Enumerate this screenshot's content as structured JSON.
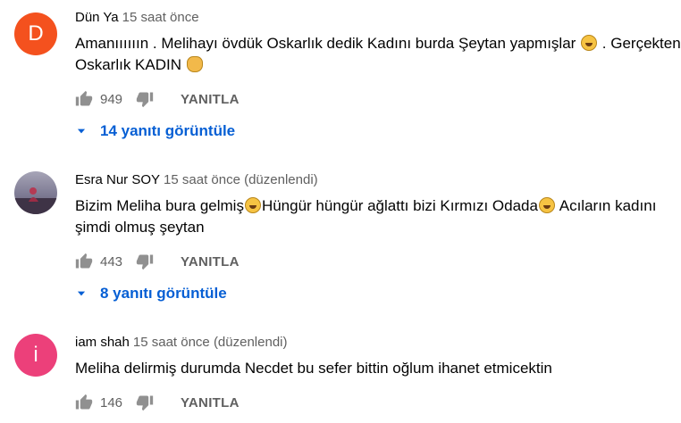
{
  "comments": [
    {
      "author": "Dün Ya",
      "time": "15 saat önce",
      "avatar_letter": "D",
      "avatar_color": "#f4511e",
      "text_line1_a": "Amanıııııın . Melihayı övdük Oskarlık dedik Kadını burda Şeytan yapmışlar",
      "text_line1_b": " . Gerçekten",
      "text_line2": "Oskarlık KADIN",
      "likes": "949",
      "reply_label": "YANITLA",
      "replies_label": "14 yanıtı görüntüle"
    },
    {
      "author": "Esra Nur SOY",
      "time": "15 saat önce (düzenlendi)",
      "text_line1_a": "Bizim Meliha bura gelmiş",
      "text_line1_b": "Hüngür hüngür ağlattı bizi Kırmızı Odada",
      "text_line1_c": "Acıların kadını",
      "text_line2": "şimdi olmuş şeytan",
      "likes": "443",
      "reply_label": "YANITLA",
      "replies_label": "8 yanıtı görüntüle"
    },
    {
      "author": "iam shah",
      "time": "15 saat önce (düzenlendi)",
      "avatar_letter": "i",
      "avatar_color": "#ec407a",
      "text_line1": "Meliha delirmiş durumda Necdet bu sefer bittin oğlum ihanet etmicektin",
      "likes": "146",
      "reply_label": "YANITLA"
    }
  ],
  "colors": {
    "link": "#065fd4",
    "meta": "#606060",
    "icon": "#909090"
  },
  "icons": [
    "thumb-up-icon",
    "thumb-down-icon",
    "caret-down-icon",
    "grinning-emoji",
    "clapping-hands-emoji"
  ]
}
